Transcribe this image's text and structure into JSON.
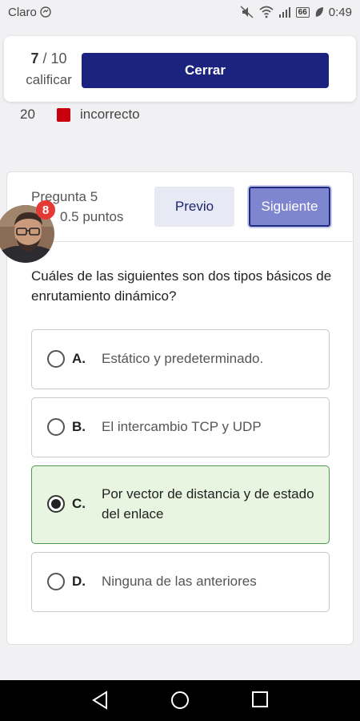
{
  "status_bar": {
    "carrier": "Claro",
    "battery": "66",
    "time": "0:49"
  },
  "top": {
    "score_current": "7",
    "score_total": "/ 10",
    "score_label": "calificar",
    "close_label": "Cerrar"
  },
  "legend": {
    "count": "20",
    "label": "incorrecto",
    "color": "#c8000b"
  },
  "question": {
    "title": "Pregunta 5",
    "points": "0.5 puntos",
    "prev_label": "Previo",
    "next_label": "Siguiente",
    "text": "Cuáles de las siguientes son dos tipos básicos de enrutamiento dinámico?",
    "options": [
      {
        "letter": "A.",
        "text": "Estático y predeterminado.",
        "selected": false
      },
      {
        "letter": "B.",
        "text": "El intercambio TCP y UDP",
        "selected": false
      },
      {
        "letter": "C.",
        "text": "Por vector de distancia y de estado del enlace",
        "selected": true
      },
      {
        "letter": "D.",
        "text": "Ninguna de las anteriores",
        "selected": false
      }
    ]
  },
  "avatar": {
    "badge": "8"
  },
  "colors": {
    "primary": "#1b237f",
    "next_button": "#7d86ce",
    "prev_button": "#e7e9f5",
    "selected_bg": "#e8f5e1",
    "selected_border": "#4c9a4c",
    "badge": "#e53935"
  },
  "nav_icons": [
    "back-icon",
    "home-icon",
    "recents-icon"
  ]
}
